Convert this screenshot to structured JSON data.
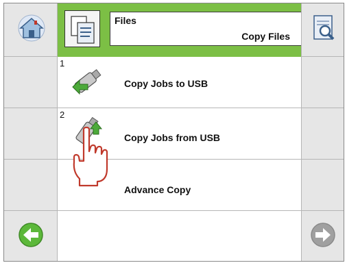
{
  "header": {
    "title": "Files",
    "subtitle": "Copy Files"
  },
  "icons": {
    "home": "house-icon",
    "files": "documents-icon",
    "preview": "magnifier-document-icon",
    "back": "left-arrow-icon",
    "next": "right-arrow-icon"
  },
  "menu": [
    {
      "number": "1",
      "label": "Copy Jobs to USB"
    },
    {
      "number": "2",
      "label": "Copy Jobs from USB"
    },
    {
      "number": "",
      "label": "Advance Copy"
    }
  ],
  "colors": {
    "header": "#7cbf45",
    "back_arrow": "#5cb83a",
    "next_arrow_disabled": "#a0a0a0"
  }
}
